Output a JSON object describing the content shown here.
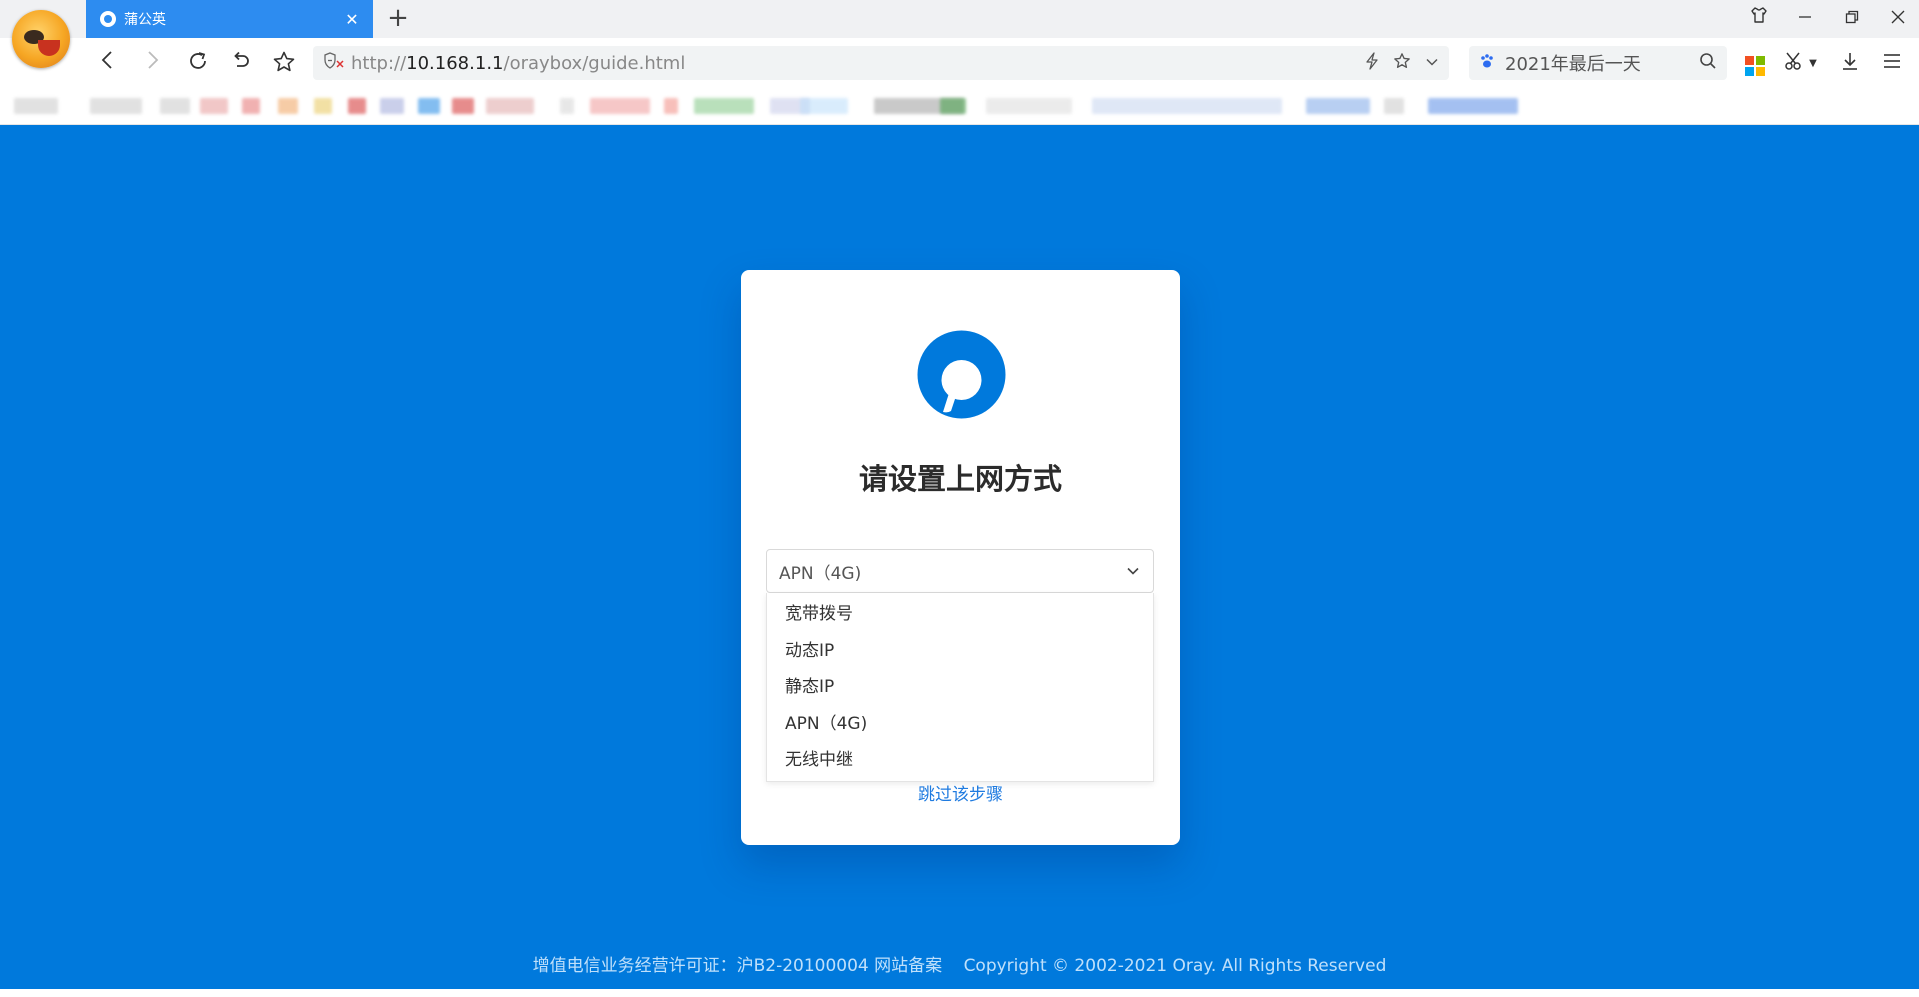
{
  "browser": {
    "tab": {
      "title": "蒲公英"
    },
    "url": {
      "prefix": "http://",
      "host": "10.168.1.1",
      "path": "/oraybox/guide.html"
    },
    "search": {
      "text": "2021年最后一天"
    }
  },
  "page": {
    "title": "请设置上网方式",
    "select": {
      "value": "APN（4G)",
      "options": [
        "宽带拨号",
        "动态IP",
        "静态IP",
        "APN（4G)",
        "无线中继"
      ]
    },
    "skip_label": "跳过该步骤",
    "footer": {
      "license": "增值电信业务经营许可证：沪B2-20100004 网站备案",
      "copyright": "Copyright © 2002-2021 Oray. All Rights Reserved"
    }
  },
  "colors": {
    "page_bg": "#0079dc",
    "accent": "#2d8cf0",
    "link": "#1f7be0"
  }
}
